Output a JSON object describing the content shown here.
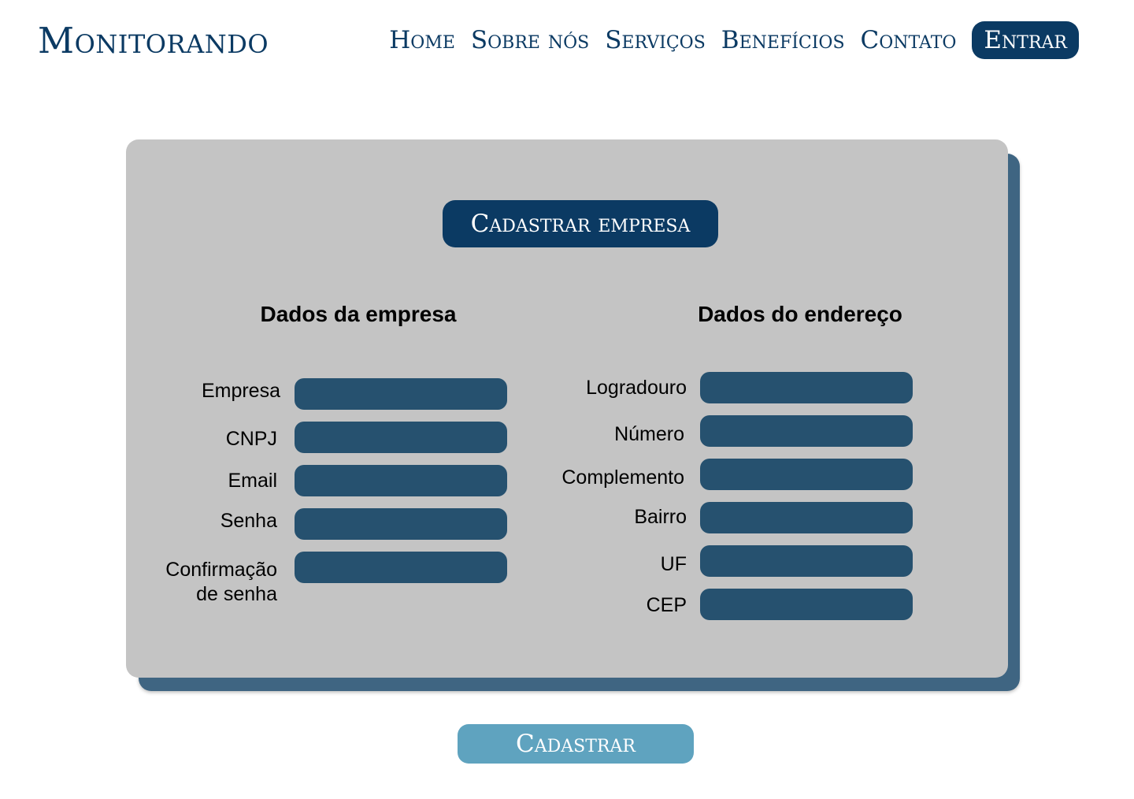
{
  "header": {
    "brand": "Monitorando",
    "nav": [
      "Home",
      "Sobre nós",
      "Serviços",
      "Benefícios",
      "Contato"
    ],
    "login_label": "Entrar"
  },
  "form": {
    "title": "Cadastrar empresa",
    "company_section": {
      "heading": "Dados da empresa",
      "fields": [
        {
          "label": "Empresa",
          "value": ""
        },
        {
          "label": "CNPJ",
          "value": ""
        },
        {
          "label": "Email",
          "value": ""
        },
        {
          "label": "Senha",
          "value": ""
        },
        {
          "label": "Confirmação\nde senha",
          "value": ""
        }
      ]
    },
    "address_section": {
      "heading": "Dados do endereço",
      "fields": [
        {
          "label": "Logradouro",
          "value": ""
        },
        {
          "label": "Número",
          "value": ""
        },
        {
          "label": "Complemento",
          "value": ""
        },
        {
          "label": "Bairro",
          "value": ""
        },
        {
          "label": "UF",
          "value": ""
        },
        {
          "label": "CEP",
          "value": ""
        }
      ]
    },
    "submit_label": "Cadastrar"
  },
  "colors": {
    "primary": "#0b3a63",
    "field": "#26516f",
    "card": "#c4c4c4",
    "card_shadow": "#3f6582",
    "submit": "#5fa3bf"
  }
}
